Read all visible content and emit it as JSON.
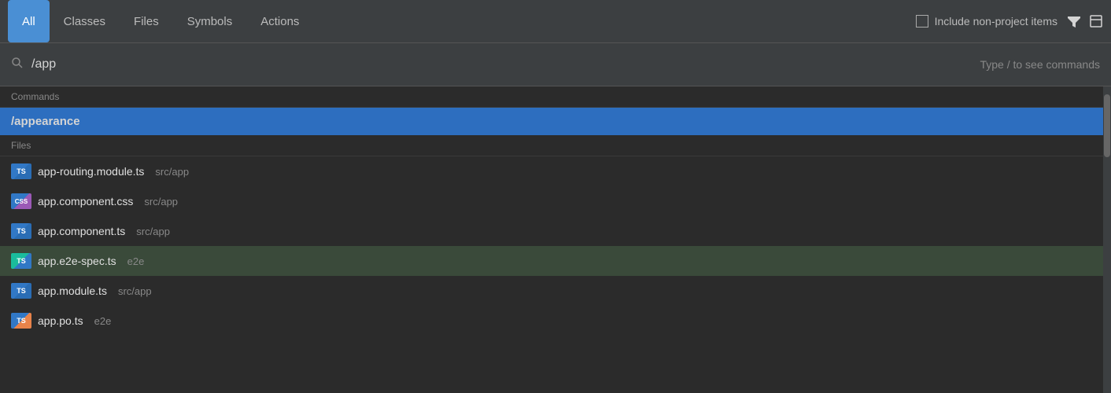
{
  "tabs": {
    "items": [
      {
        "id": "all",
        "label": "All",
        "active": true
      },
      {
        "id": "classes",
        "label": "Classes",
        "active": false
      },
      {
        "id": "files",
        "label": "Files",
        "active": false
      },
      {
        "id": "symbols",
        "label": "Symbols",
        "active": false
      },
      {
        "id": "actions",
        "label": "Actions",
        "active": false
      }
    ]
  },
  "header": {
    "include_non_project_label": "Include non-project items",
    "filter_icon": "▼",
    "window_icon": "▢"
  },
  "search": {
    "value": "/app",
    "hint": "Type / to see commands"
  },
  "sections": {
    "commands_header": "Commands",
    "files_header": "Files"
  },
  "commands": [
    {
      "id": "cmd1",
      "label": "/appearance"
    }
  ],
  "files": [
    {
      "id": "f1",
      "name": "app-routing.module.ts",
      "path": "src/app",
      "icon_type": "ts",
      "highlighted": false
    },
    {
      "id": "f2",
      "name": "app.component.css",
      "path": "src/app",
      "icon_type": "css",
      "highlighted": false
    },
    {
      "id": "f3",
      "name": "app.component.ts",
      "path": "src/app",
      "icon_type": "ts",
      "highlighted": false
    },
    {
      "id": "f4",
      "name": "app.e2e-spec.ts",
      "path": "e2e",
      "icon_type": "ts-teal",
      "highlighted": true
    },
    {
      "id": "f5",
      "name": "app.module.ts",
      "path": "src/app",
      "icon_type": "ts",
      "highlighted": false
    },
    {
      "id": "f6",
      "name": "app.po.ts",
      "path": "e2e",
      "icon_type": "ts-orange",
      "highlighted": false
    }
  ]
}
